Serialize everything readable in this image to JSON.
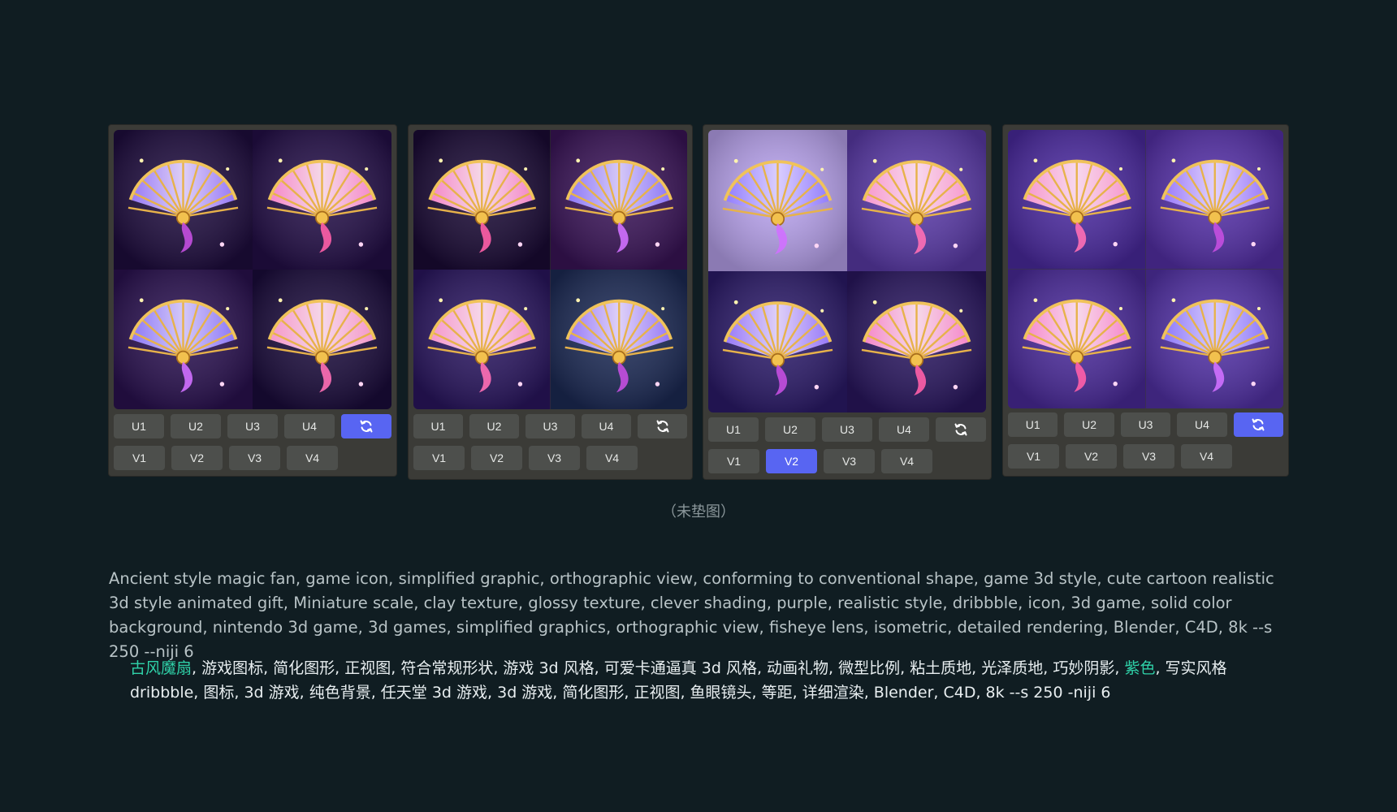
{
  "cards": [
    {
      "row1": [
        "U1",
        "U2",
        "U3",
        "U4"
      ],
      "row2": [
        "V1",
        "V2",
        "V3",
        "V4"
      ],
      "active": "refresh",
      "refresh_icon": "refresh-icon"
    },
    {
      "row1": [
        "U1",
        "U2",
        "U3",
        "U4"
      ],
      "row2": [
        "V1",
        "V2",
        "V3",
        "V4"
      ],
      "active": "none",
      "refresh_icon": "refresh-icon"
    },
    {
      "row1": [
        "U1",
        "U2",
        "U3",
        "U4"
      ],
      "row2": [
        "V1",
        "V2",
        "V3",
        "V4"
      ],
      "active": "V2",
      "refresh_icon": "refresh-icon"
    },
    {
      "row1": [
        "U1",
        "U2",
        "U3",
        "U4"
      ],
      "row2": [
        "V1",
        "V2",
        "V3",
        "V4"
      ],
      "active": "refresh",
      "refresh_icon": "refresh-icon"
    }
  ],
  "caption": "（未垫图）",
  "prompt_en": "Ancient style magic fan, game icon, simplified graphic, orthographic view, conforming to conventional shape, game 3d style, cute cartoon realistic 3d style animated gift, Miniature scale, clay texture, glossy texture, clever shading, purple, realistic style, dribbble, icon, 3d game, solid color background, nintendo 3d game, 3d games, simplified graphics, orthographic view, fisheye lens, isometric, detailed rendering, Blender, C4D, 8k --s 250 --niji 6",
  "prompt_cn": {
    "highlight_1": "古风魔扇",
    "part_1": ", 游戏图标, 简化图形, 正视图, 符合常规形状, 游戏 3d 风格, 可爱卡通逼真 3d 风格, 动画礼物, 微型比例, 粘土质地, 光泽质地, 巧妙阴影, ",
    "highlight_2": "紫色",
    "part_2": ", 写实风格 dribbble, 图标, 3d 游戏, 纯色背景, 任天堂 3d 游戏, 3d 游戏, 简化图形, 正视图, 鱼眼镜头, 等距, 详细渲染, Blender, C4D, 8k --s 250 -niji 6"
  },
  "colors": {
    "background": "#101d22",
    "card": "#3b3b37",
    "button": "#4d4f4c",
    "button_active": "#5865f2",
    "highlight": "#2fd1a8"
  }
}
